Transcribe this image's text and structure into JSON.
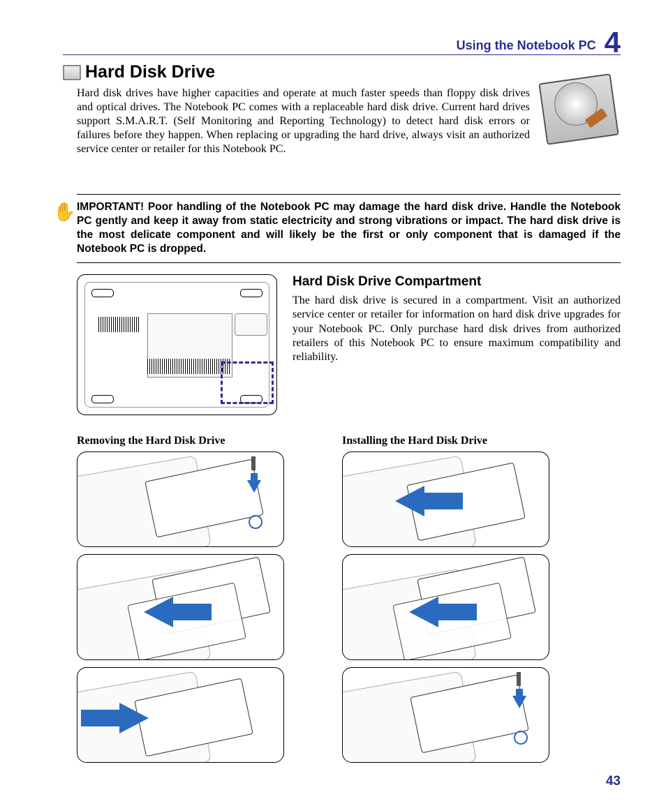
{
  "header": {
    "chapter_title": "Using the Notebook PC",
    "chapter_number": "4"
  },
  "section": {
    "title": "Hard Disk Drive",
    "intro": "Hard disk drives have higher capacities and operate at much faster speeds than floppy disk drives and optical drives. The Notebook PC comes with a replaceable hard disk drive. Current hard drives support S.M.A.R.T. (Self Monitoring and Reporting Technology) to detect hard disk errors or failures before they happen. When replacing or upgrading the hard drive, always visit an authorized service center or retailer for this Notebook PC."
  },
  "important": {
    "text": "IMPORTANT!  Poor handling of the Notebook PC may damage the hard disk drive. Handle the Notebook PC gently and keep it away from static electricity and strong vibrations or impact. The hard disk drive is the most delicate component and will likely be the first or only component that is damaged if the Notebook PC is dropped."
  },
  "compartment": {
    "title": "Hard Disk Drive Compartment",
    "text": "The hard disk drive is secured in a compartment. Visit an authorized service center or retailer for information on hard disk drive upgrades for your Notebook PC. Only purchase hard disk drives from authorized retailers of this Notebook PC to ensure maximum compatibility and reliability."
  },
  "procedures": {
    "removing_title": "Removing the Hard Disk Drive",
    "installing_title": "Installing the Hard Disk Drive"
  },
  "page_number": "43"
}
